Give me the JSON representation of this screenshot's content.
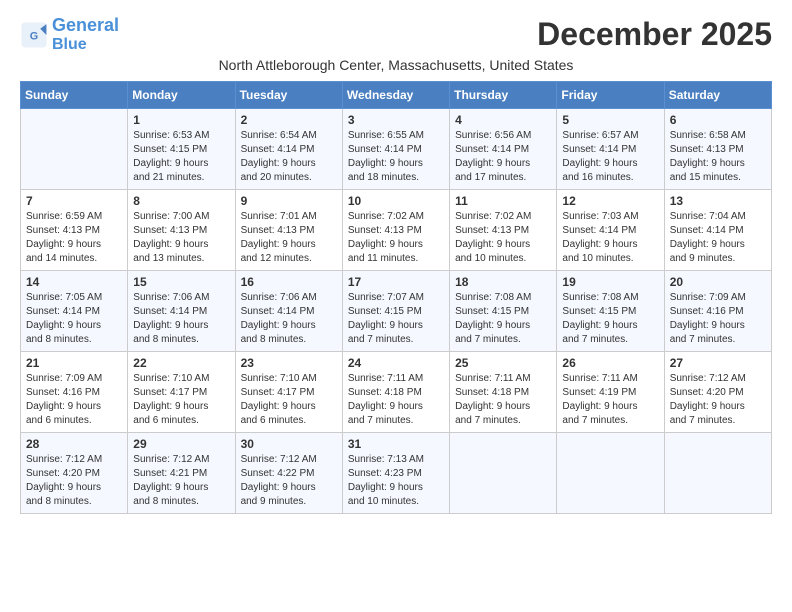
{
  "logo": {
    "line1": "General",
    "line2": "Blue"
  },
  "title": "December 2025",
  "location": "North Attleborough Center, Massachusetts, United States",
  "days_of_week": [
    "Sunday",
    "Monday",
    "Tuesday",
    "Wednesday",
    "Thursday",
    "Friday",
    "Saturday"
  ],
  "weeks": [
    [
      {
        "day": "",
        "info": ""
      },
      {
        "day": "1",
        "info": "Sunrise: 6:53 AM\nSunset: 4:15 PM\nDaylight: 9 hours\nand 21 minutes."
      },
      {
        "day": "2",
        "info": "Sunrise: 6:54 AM\nSunset: 4:14 PM\nDaylight: 9 hours\nand 20 minutes."
      },
      {
        "day": "3",
        "info": "Sunrise: 6:55 AM\nSunset: 4:14 PM\nDaylight: 9 hours\nand 18 minutes."
      },
      {
        "day": "4",
        "info": "Sunrise: 6:56 AM\nSunset: 4:14 PM\nDaylight: 9 hours\nand 17 minutes."
      },
      {
        "day": "5",
        "info": "Sunrise: 6:57 AM\nSunset: 4:14 PM\nDaylight: 9 hours\nand 16 minutes."
      },
      {
        "day": "6",
        "info": "Sunrise: 6:58 AM\nSunset: 4:13 PM\nDaylight: 9 hours\nand 15 minutes."
      }
    ],
    [
      {
        "day": "7",
        "info": "Sunrise: 6:59 AM\nSunset: 4:13 PM\nDaylight: 9 hours\nand 14 minutes."
      },
      {
        "day": "8",
        "info": "Sunrise: 7:00 AM\nSunset: 4:13 PM\nDaylight: 9 hours\nand 13 minutes."
      },
      {
        "day": "9",
        "info": "Sunrise: 7:01 AM\nSunset: 4:13 PM\nDaylight: 9 hours\nand 12 minutes."
      },
      {
        "day": "10",
        "info": "Sunrise: 7:02 AM\nSunset: 4:13 PM\nDaylight: 9 hours\nand 11 minutes."
      },
      {
        "day": "11",
        "info": "Sunrise: 7:02 AM\nSunset: 4:13 PM\nDaylight: 9 hours\nand 10 minutes."
      },
      {
        "day": "12",
        "info": "Sunrise: 7:03 AM\nSunset: 4:14 PM\nDaylight: 9 hours\nand 10 minutes."
      },
      {
        "day": "13",
        "info": "Sunrise: 7:04 AM\nSunset: 4:14 PM\nDaylight: 9 hours\nand 9 minutes."
      }
    ],
    [
      {
        "day": "14",
        "info": "Sunrise: 7:05 AM\nSunset: 4:14 PM\nDaylight: 9 hours\nand 8 minutes."
      },
      {
        "day": "15",
        "info": "Sunrise: 7:06 AM\nSunset: 4:14 PM\nDaylight: 9 hours\nand 8 minutes."
      },
      {
        "day": "16",
        "info": "Sunrise: 7:06 AM\nSunset: 4:14 PM\nDaylight: 9 hours\nand 8 minutes."
      },
      {
        "day": "17",
        "info": "Sunrise: 7:07 AM\nSunset: 4:15 PM\nDaylight: 9 hours\nand 7 minutes."
      },
      {
        "day": "18",
        "info": "Sunrise: 7:08 AM\nSunset: 4:15 PM\nDaylight: 9 hours\nand 7 minutes."
      },
      {
        "day": "19",
        "info": "Sunrise: 7:08 AM\nSunset: 4:15 PM\nDaylight: 9 hours\nand 7 minutes."
      },
      {
        "day": "20",
        "info": "Sunrise: 7:09 AM\nSunset: 4:16 PM\nDaylight: 9 hours\nand 7 minutes."
      }
    ],
    [
      {
        "day": "21",
        "info": "Sunrise: 7:09 AM\nSunset: 4:16 PM\nDaylight: 9 hours\nand 6 minutes."
      },
      {
        "day": "22",
        "info": "Sunrise: 7:10 AM\nSunset: 4:17 PM\nDaylight: 9 hours\nand 6 minutes."
      },
      {
        "day": "23",
        "info": "Sunrise: 7:10 AM\nSunset: 4:17 PM\nDaylight: 9 hours\nand 6 minutes."
      },
      {
        "day": "24",
        "info": "Sunrise: 7:11 AM\nSunset: 4:18 PM\nDaylight: 9 hours\nand 7 minutes."
      },
      {
        "day": "25",
        "info": "Sunrise: 7:11 AM\nSunset: 4:18 PM\nDaylight: 9 hours\nand 7 minutes."
      },
      {
        "day": "26",
        "info": "Sunrise: 7:11 AM\nSunset: 4:19 PM\nDaylight: 9 hours\nand 7 minutes."
      },
      {
        "day": "27",
        "info": "Sunrise: 7:12 AM\nSunset: 4:20 PM\nDaylight: 9 hours\nand 7 minutes."
      }
    ],
    [
      {
        "day": "28",
        "info": "Sunrise: 7:12 AM\nSunset: 4:20 PM\nDaylight: 9 hours\nand 8 minutes."
      },
      {
        "day": "29",
        "info": "Sunrise: 7:12 AM\nSunset: 4:21 PM\nDaylight: 9 hours\nand 8 minutes."
      },
      {
        "day": "30",
        "info": "Sunrise: 7:12 AM\nSunset: 4:22 PM\nDaylight: 9 hours\nand 9 minutes."
      },
      {
        "day": "31",
        "info": "Sunrise: 7:13 AM\nSunset: 4:23 PM\nDaylight: 9 hours\nand 10 minutes."
      },
      {
        "day": "",
        "info": ""
      },
      {
        "day": "",
        "info": ""
      },
      {
        "day": "",
        "info": ""
      }
    ]
  ]
}
